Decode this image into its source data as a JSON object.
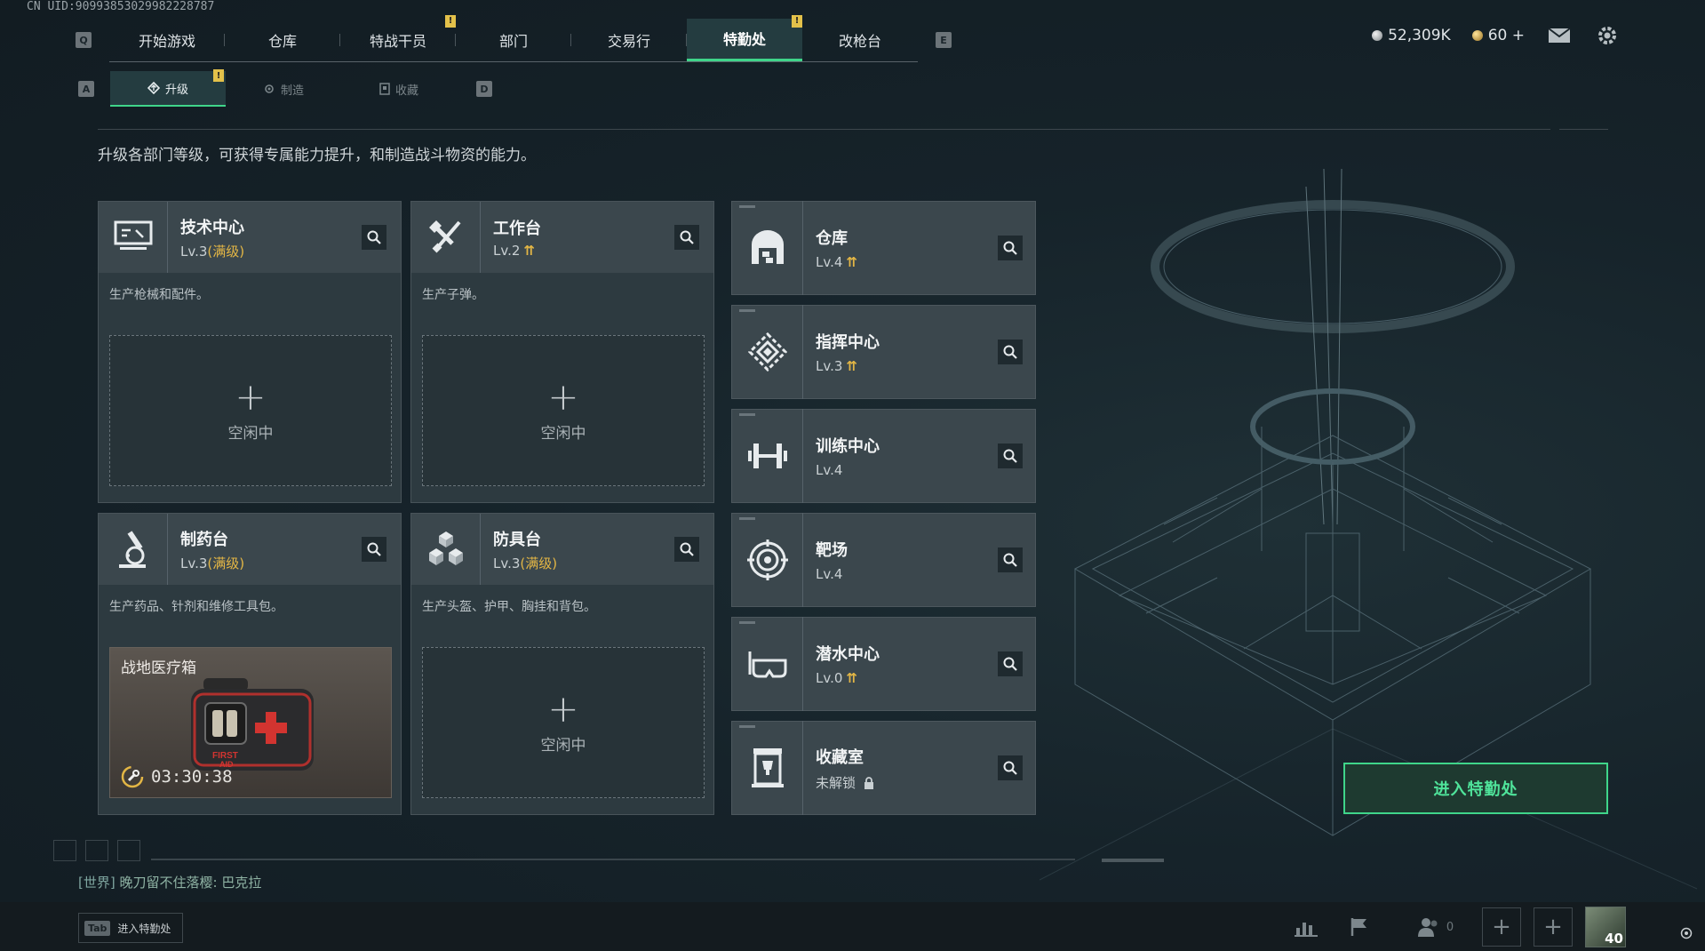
{
  "uid": "CN UID:9099385302998222878​7",
  "nav": {
    "left_key": "Q",
    "right_key": "E",
    "tabs": [
      "开始游戏",
      "仓库",
      "特战干员",
      "部门",
      "交易行",
      "特勤处",
      "改枪台"
    ],
    "active_tab": "特勤处",
    "notif_glyph": "!"
  },
  "currency": {
    "silver": "52,309K",
    "gold": "60",
    "gold_plus": "+"
  },
  "subnav": {
    "left_key": "A",
    "right_key": "D",
    "tabs": [
      "升级",
      "制造",
      "收藏"
    ],
    "active": "升级"
  },
  "description": "升级各部门等级，可获得专属能力提升，和制造战斗物资的能力。",
  "left_cards": [
    {
      "name": "技术中心",
      "level": "Lv.3",
      "max_label": "(满级)",
      "desc": "生产枪械和配件。",
      "status": "空闲中",
      "icon": "monitor-icon"
    },
    {
      "name": "工作台",
      "level": "Lv.2",
      "upgrade": "⇈",
      "desc": "生产子弹。",
      "status": "空闲中",
      "icon": "tools-icon"
    },
    {
      "name": "制药台",
      "level": "Lv.3",
      "max_label": "(满级)",
      "desc": "生产药品、针剂和维修工具包。",
      "item_name": "战地医疗箱",
      "timer": "03:30:38",
      "icon": "microscope-icon"
    },
    {
      "name": "防具台",
      "level": "Lv.3",
      "max_label": "(满级)",
      "desc": "生产头盔、护甲、胸挂和背包。",
      "status": "空闲中",
      "icon": "cubes-icon"
    }
  ],
  "right_cards": [
    {
      "name": "仓库",
      "level": "Lv.4",
      "upgrade": "⇈",
      "icon": "warehouse-icon"
    },
    {
      "name": "指挥中心",
      "level": "Lv.3",
      "upgrade": "⇈",
      "icon": "command-icon"
    },
    {
      "name": "训练中心",
      "level": "Lv.4",
      "icon": "dumbbell-icon"
    },
    {
      "name": "靶场",
      "level": "Lv.4",
      "icon": "target-icon"
    },
    {
      "name": "潜水中心",
      "level": "Lv.0",
      "upgrade": "⇈",
      "icon": "diving-mask-icon"
    },
    {
      "name": "收藏室",
      "level": "未解锁",
      "icon": "trophy-icon"
    }
  ],
  "plus_glyph": "+",
  "enter_button": "进入特勤处",
  "chat": {
    "channel": "[世界]",
    "message": "晚刀留不住落樱: 巴克拉"
  },
  "tab_hint": {
    "key": "Tab",
    "label": "进入特勤处"
  },
  "bottom": {
    "friends_count": "0",
    "avatar_level": "40"
  }
}
